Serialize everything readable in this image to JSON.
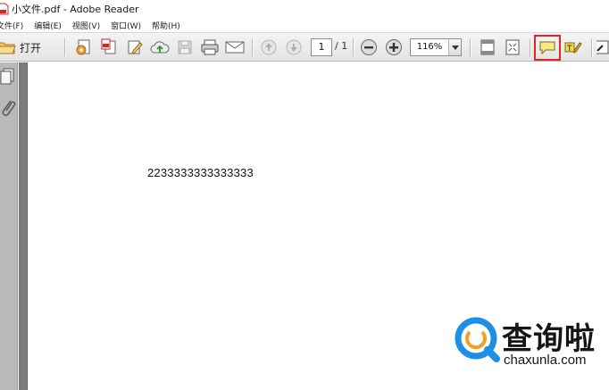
{
  "window": {
    "title": "小文件.pdf - Adobe Reader"
  },
  "menu": {
    "items": [
      {
        "label": "文件(F)"
      },
      {
        "label": "编辑(E)"
      },
      {
        "label": "视图(V)"
      },
      {
        "label": "窗口(W)"
      },
      {
        "label": "帮助(H)"
      }
    ]
  },
  "toolbar": {
    "open_label": "打开",
    "page_current": "1",
    "page_total": "/ 1",
    "zoom": "116%",
    "highlighted_tool": "comment-icon",
    "highlight_color": "#e0262c"
  },
  "document": {
    "text": "2233333333333333"
  },
  "watermark": {
    "chinese": "查询啦",
    "url": "chaxunla.com",
    "logo_color": "#1e8fe6"
  }
}
